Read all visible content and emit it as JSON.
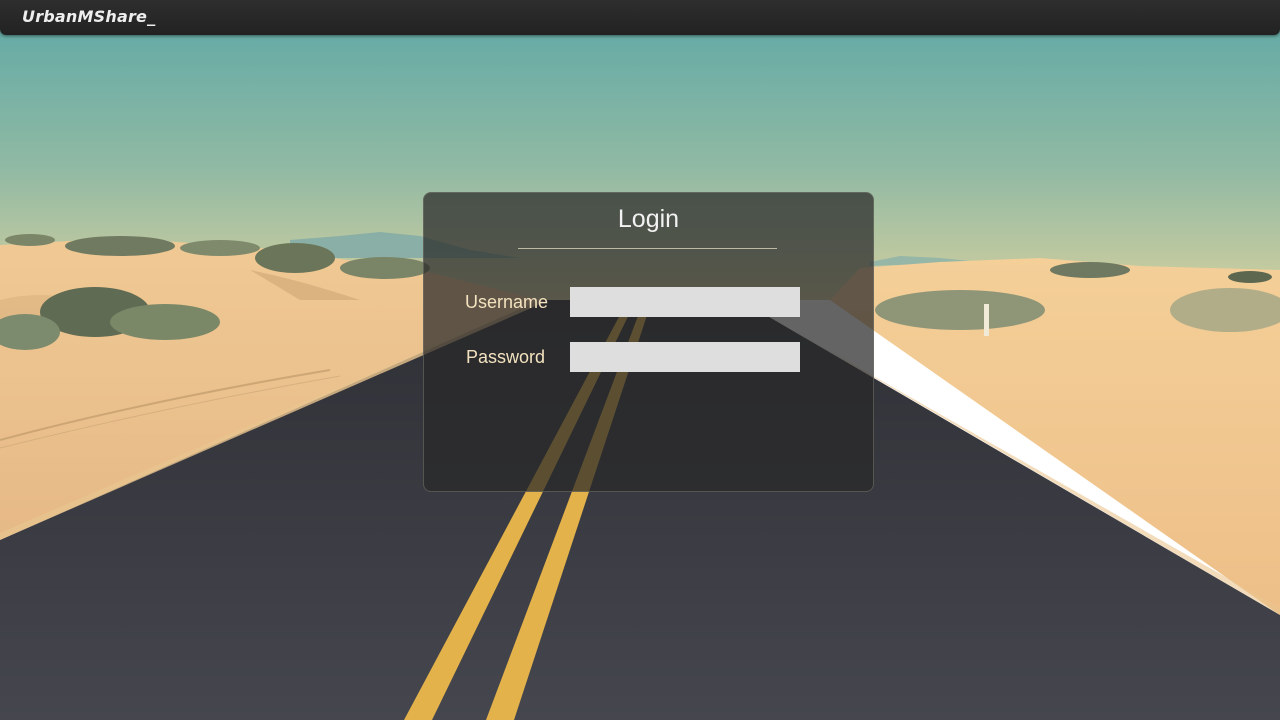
{
  "app": {
    "brand": "UrbanMShare_"
  },
  "background": {
    "description_icon": "desert-road-photo",
    "sky_color": "#6aaca7",
    "sand_color": "#e8c18a",
    "road_color": "#3a3a40",
    "line_color": "#e3b24a"
  },
  "login": {
    "title": "Login",
    "username_label": "Username",
    "username_value": "",
    "password_label": "Password",
    "password_value": ""
  }
}
